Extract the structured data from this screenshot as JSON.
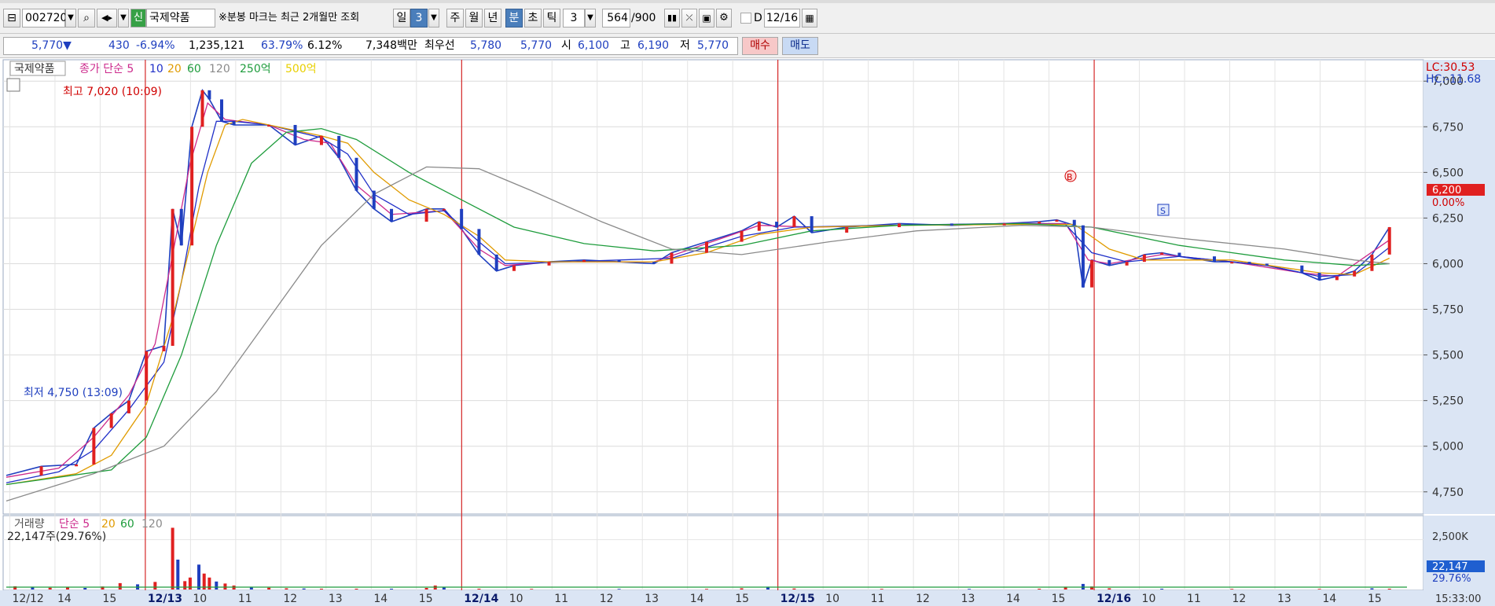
{
  "toolbar": {
    "code": "002720",
    "badge": "신",
    "name": "국제약품",
    "notice": "※분봉 마크는 최근 2개월만 조회",
    "period_day": "일",
    "period_day_n": "3",
    "period_week": "주",
    "period_month": "월",
    "period_year": "년",
    "period_min": "분",
    "period_sec": "초",
    "period_tick": "틱",
    "interval": "3",
    "count": "564",
    "count_total": "/900",
    "d_label": "D",
    "date": "12/16"
  },
  "info": {
    "price": "5,770▼",
    "change": "430",
    "change_pct": "-6.94%",
    "volume": "1,235,121",
    "vol_ratio": "63.79%",
    "turnover": "6.12%",
    "amount": "7,348백만",
    "best_label": "최우선",
    "ask": "5,780",
    "bid": "5,770",
    "open_label": "시",
    "open": "6,100",
    "high_label": "고",
    "high": "6,190",
    "low_label": "저",
    "low": "5,770",
    "buy": "매수",
    "sell": "매도"
  },
  "chart_data": [
    {
      "type": "line",
      "legend": [
        "국제약품",
        "종가 단순 5",
        "10",
        "20",
        "60",
        "120",
        "250억",
        "500억"
      ],
      "ylim": [
        4650,
        7100
      ],
      "y_ticks": [
        "7,000",
        "6,750",
        "6,500",
        "6,250",
        "6,000",
        "5,750",
        "5,500",
        "5,250",
        "5,000",
        "4,750"
      ],
      "x_tick_labels": [
        "12/12",
        "14",
        "15",
        "12/13",
        "10",
        "11",
        "12",
        "13",
        "14",
        "15",
        "12/14",
        "10",
        "11",
        "12",
        "13",
        "14",
        "15",
        "12/15",
        "10",
        "11",
        "12",
        "13",
        "14",
        "15",
        "12/16",
        "10",
        "11",
        "12",
        "13",
        "14",
        "15"
      ],
      "session_markers": [
        "12/13",
        "12/14",
        "12/15",
        "12/16"
      ],
      "annotations": {
        "high": "최고 7,020 (10:09)",
        "low": "최저 4,750 (13:09)",
        "lc": "LC:30.53",
        "hc": "HC:-11.68",
        "last": "6,200",
        "last_pct": "0.00%",
        "marker_b": "B",
        "marker_s": "S"
      },
      "series": [
        {
          "name": "국제약품",
          "color": "#1f3fbf",
          "points": [
            [
              0,
              4840
            ],
            [
              2,
              4890
            ],
            [
              4,
              4900
            ],
            [
              5,
              5100
            ],
            [
              6,
              5180
            ],
            [
              7,
              5250
            ],
            [
              8,
              5520
            ],
            [
              9,
              5550
            ],
            [
              9.5,
              6300
            ],
            [
              10,
              6100
            ],
            [
              10.6,
              6750
            ],
            [
              11.2,
              6950
            ],
            [
              11.6,
              6900
            ],
            [
              12.3,
              6780
            ],
            [
              13,
              6760
            ],
            [
              15,
              6760
            ],
            [
              16.5,
              6650
            ],
            [
              18,
              6700
            ],
            [
              19,
              6580
            ],
            [
              20,
              6400
            ],
            [
              21,
              6300
            ],
            [
              22,
              6230
            ],
            [
              24,
              6300
            ],
            [
              25,
              6300
            ],
            [
              26,
              6190
            ],
            [
              27,
              6050
            ],
            [
              28,
              5960
            ],
            [
              29,
              5990
            ],
            [
              31,
              6010
            ],
            [
              33,
              6020
            ],
            [
              35,
              6010
            ],
            [
              37,
              6000
            ],
            [
              38,
              6060
            ],
            [
              40,
              6120
            ],
            [
              42,
              6180
            ],
            [
              43,
              6230
            ],
            [
              44,
              6200
            ],
            [
              45,
              6260
            ],
            [
              46,
              6170
            ],
            [
              48,
              6200
            ],
            [
              51,
              6220
            ],
            [
              54,
              6210
            ],
            [
              57,
              6220
            ],
            [
              59,
              6230
            ],
            [
              60,
              6240
            ],
            [
              61,
              6210
            ],
            [
              61.5,
              5870
            ],
            [
              62,
              6020
            ],
            [
              63,
              5990
            ],
            [
              64,
              6010
            ],
            [
              65,
              6050
            ],
            [
              66,
              6060
            ],
            [
              67,
              6040
            ],
            [
              69,
              6010
            ],
            [
              70,
              6010
            ],
            [
              71,
              6000
            ],
            [
              72,
              5990
            ],
            [
              74,
              5950
            ],
            [
              75,
              5910
            ],
            [
              76,
              5930
            ],
            [
              77,
              5960
            ],
            [
              78,
              6050
            ],
            [
              79,
              6200
            ]
          ]
        },
        {
          "name": "종가 단순 5",
          "color": "#cc2a8c",
          "points": [
            [
              0,
              4830
            ],
            [
              3,
              4880
            ],
            [
              5,
              5050
            ],
            [
              7,
              5280
            ],
            [
              8.5,
              5560
            ],
            [
              9.5,
              6050
            ],
            [
              10.5,
              6550
            ],
            [
              11.5,
              6880
            ],
            [
              12.5,
              6790
            ],
            [
              15,
              6760
            ],
            [
              17,
              6680
            ],
            [
              18.5,
              6660
            ],
            [
              20,
              6430
            ],
            [
              22,
              6270
            ],
            [
              25,
              6290
            ],
            [
              27,
              6080
            ],
            [
              28.5,
              5990
            ],
            [
              31,
              6010
            ],
            [
              37,
              6010
            ],
            [
              40,
              6110
            ],
            [
              43,
              6210
            ],
            [
              46,
              6200
            ],
            [
              51,
              6210
            ],
            [
              57,
              6220
            ],
            [
              60.5,
              6220
            ],
            [
              61.8,
              6020
            ],
            [
              63,
              6000
            ],
            [
              66,
              6050
            ],
            [
              70,
              6010
            ],
            [
              74,
              5950
            ],
            [
              76,
              5930
            ],
            [
              79,
              6130
            ]
          ]
        },
        {
          "name": "10",
          "color": "#2030c8",
          "points": [
            [
              0,
              4800
            ],
            [
              3,
              4860
            ],
            [
              5,
              4980
            ],
            [
              7,
              5200
            ],
            [
              9,
              5460
            ],
            [
              10,
              5900
            ],
            [
              11,
              6420
            ],
            [
              12,
              6780
            ],
            [
              13,
              6780
            ],
            [
              15,
              6760
            ],
            [
              18,
              6690
            ],
            [
              19.5,
              6600
            ],
            [
              21,
              6380
            ],
            [
              23,
              6270
            ],
            [
              25,
              6290
            ],
            [
              27,
              6120
            ],
            [
              28.5,
              6000
            ],
            [
              32,
              6010
            ],
            [
              38,
              6030
            ],
            [
              42,
              6150
            ],
            [
              45,
              6200
            ],
            [
              50,
              6210
            ],
            [
              57,
              6220
            ],
            [
              60.5,
              6215
            ],
            [
              62,
              6060
            ],
            [
              64,
              6010
            ],
            [
              67,
              6040
            ],
            [
              72,
              5990
            ],
            [
              75,
              5930
            ],
            [
              77,
              5940
            ],
            [
              79,
              6090
            ]
          ]
        },
        {
          "name": "20",
          "color": "#e09b00",
          "points": [
            [
              0,
              4790
            ],
            [
              4,
              4850
            ],
            [
              6,
              4950
            ],
            [
              8,
              5230
            ],
            [
              9.5,
              5700
            ],
            [
              10.5,
              6100
            ],
            [
              11.5,
              6500
            ],
            [
              12.5,
              6760
            ],
            [
              13.5,
              6790
            ],
            [
              16,
              6740
            ],
            [
              18,
              6700
            ],
            [
              19.5,
              6660
            ],
            [
              21,
              6500
            ],
            [
              23,
              6350
            ],
            [
              25,
              6270
            ],
            [
              27,
              6150
            ],
            [
              28.5,
              6020
            ],
            [
              31,
              6010
            ],
            [
              37,
              6010
            ],
            [
              40,
              6060
            ],
            [
              43,
              6160
            ],
            [
              46,
              6200
            ],
            [
              51,
              6210
            ],
            [
              58,
              6215
            ],
            [
              61,
              6215
            ],
            [
              63,
              6080
            ],
            [
              65,
              6020
            ],
            [
              70,
              6020
            ],
            [
              75,
              5950
            ],
            [
              77,
              5940
            ],
            [
              79,
              6030
            ]
          ]
        },
        {
          "name": "60",
          "color": "#1e9c3c",
          "points": [
            [
              0,
              4790
            ],
            [
              6,
              4870
            ],
            [
              8,
              5050
            ],
            [
              10,
              5500
            ],
            [
              12,
              6100
            ],
            [
              14,
              6550
            ],
            [
              16,
              6720
            ],
            [
              18,
              6740
            ],
            [
              20,
              6680
            ],
            [
              23,
              6500
            ],
            [
              26,
              6350
            ],
            [
              29,
              6200
            ],
            [
              33,
              6110
            ],
            [
              37,
              6070
            ],
            [
              42,
              6100
            ],
            [
              46,
              6180
            ],
            [
              51,
              6210
            ],
            [
              58,
              6220
            ],
            [
              62,
              6200
            ],
            [
              67,
              6100
            ],
            [
              73,
              6020
            ],
            [
              77,
              5990
            ],
            [
              79,
              6000
            ]
          ]
        },
        {
          "name": "120",
          "color": "#8a8a8a",
          "points": [
            [
              0,
              4700
            ],
            [
              5,
              4850
            ],
            [
              9,
              5000
            ],
            [
              12,
              5300
            ],
            [
              15,
              5700
            ],
            [
              18,
              6100
            ],
            [
              21,
              6380
            ],
            [
              24,
              6530
            ],
            [
              27,
              6520
            ],
            [
              30,
              6400
            ],
            [
              34,
              6230
            ],
            [
              38,
              6080
            ],
            [
              42,
              6050
            ],
            [
              47,
              6120
            ],
            [
              52,
              6180
            ],
            [
              58,
              6210
            ],
            [
              62,
              6200
            ],
            [
              67,
              6140
            ],
            [
              73,
              6080
            ],
            [
              77,
              6020
            ],
            [
              79,
              6000
            ]
          ]
        }
      ]
    },
    {
      "type": "bar",
      "legend": [
        "거래량",
        "단순 5",
        "20",
        "60",
        "120"
      ],
      "summary": "22,147주(29.76%)",
      "y_ticks": [
        "2,500K"
      ],
      "last": "22,147",
      "last_pct": "29.76%",
      "ylim": [
        0,
        3000
      ],
      "bars": [
        [
          0.5,
          160
        ],
        [
          1.5,
          140
        ],
        [
          2.5,
          90
        ],
        [
          3.5,
          120
        ],
        [
          4.5,
          80
        ],
        [
          5.5,
          150
        ],
        [
          6.5,
          320
        ],
        [
          7.5,
          260
        ],
        [
          8.5,
          380
        ],
        [
          9.5,
          3100
        ],
        [
          9.8,
          1500
        ],
        [
          10.2,
          420
        ],
        [
          10.5,
          600
        ],
        [
          11,
          1250
        ],
        [
          11.3,
          800
        ],
        [
          11.6,
          600
        ],
        [
          12,
          400
        ],
        [
          12.5,
          300
        ],
        [
          13,
          200
        ],
        [
          14,
          120
        ],
        [
          15,
          90
        ],
        [
          16,
          60
        ],
        [
          17,
          50
        ],
        [
          18,
          40
        ],
        [
          20,
          40
        ],
        [
          22,
          40
        ],
        [
          24,
          80
        ],
        [
          24.5,
          200
        ],
        [
          25,
          120
        ],
        [
          27,
          40
        ],
        [
          30,
          30
        ],
        [
          35,
          30
        ],
        [
          40,
          30
        ],
        [
          42,
          60
        ],
        [
          43.5,
          140
        ],
        [
          45,
          50
        ],
        [
          50,
          30
        ],
        [
          55,
          30
        ],
        [
          59,
          40
        ],
        [
          60.5,
          140
        ],
        [
          61.5,
          280
        ],
        [
          62,
          150
        ],
        [
          63,
          60
        ],
        [
          66,
          40
        ],
        [
          70,
          30
        ],
        [
          75,
          30
        ],
        [
          78,
          60
        ],
        [
          79,
          40
        ]
      ]
    }
  ]
}
